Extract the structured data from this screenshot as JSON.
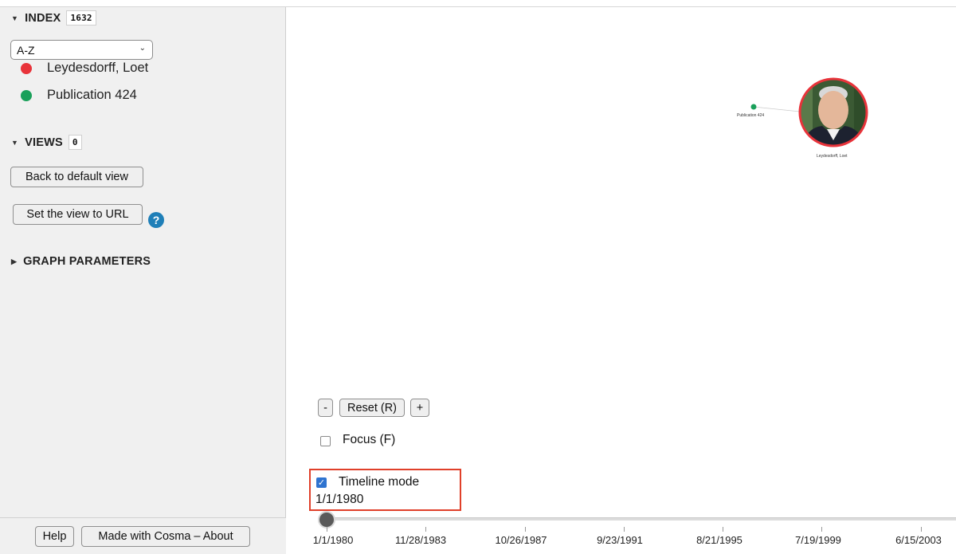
{
  "sidebar": {
    "index": {
      "title": "INDEX",
      "count": "1632",
      "sort_value": "A-Z",
      "items": [
        {
          "label": "Leydesdorff, Loet",
          "color": "#e8333a"
        },
        {
          "label": "Publication 424",
          "color": "#1aa05a"
        }
      ]
    },
    "views": {
      "title": "VIEWS",
      "count": "0",
      "back_label": "Back to default view",
      "url_label": "Set the view to URL",
      "help_glyph": "?"
    },
    "graph_parameters": {
      "title": "GRAPH PARAMETERS"
    },
    "footer": {
      "help_label": "Help",
      "about_label": "Made with Cosma – About"
    }
  },
  "graph": {
    "nodes": [
      {
        "label": "Publication 424",
        "color": "#1aa05a"
      },
      {
        "label": "Leydesdorff, Loet",
        "color": "#e8333a"
      }
    ]
  },
  "controls": {
    "zoom_out": "-",
    "reset": "Reset (R)",
    "zoom_in": "+",
    "focus_label": "Focus (F)",
    "focus_checked": false,
    "timeline_label": "Timeline mode",
    "timeline_checked": true,
    "timeline_date": "1/1/1980"
  },
  "timeline": {
    "ticks": [
      "1/1/1980",
      "11/28/1983",
      "10/26/1987",
      "9/23/1991",
      "8/21/1995",
      "7/19/1999",
      "6/15/2003"
    ]
  }
}
